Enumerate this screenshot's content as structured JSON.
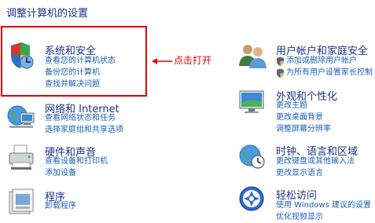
{
  "page": {
    "title": "调整计算机的设置"
  },
  "annotation": {
    "text": "点击打开",
    "color": "#e00000"
  },
  "categories": {
    "system_security": {
      "title": "系统和安全",
      "links": [
        "查看您的计算机状态",
        "备份您的计算机",
        "查找并解决问题"
      ]
    },
    "network_internet": {
      "title": "网络和 Internet",
      "links": [
        "查看网络状态和任务",
        "选择家庭组和共享选项"
      ]
    },
    "hardware_sound": {
      "title": "硬件和声音",
      "links": [
        "查看设备和打印机",
        "添加设备"
      ]
    },
    "programs": {
      "title": "程序",
      "links": [
        "卸载程序"
      ]
    },
    "user_accounts": {
      "title": "用户帐户和家庭安全",
      "links": [
        "添加或删除用户帐户",
        "为所有用户设置家长控制"
      ]
    },
    "appearance": {
      "title": "外观和个性化",
      "links": [
        "更改主题",
        "更改桌面背景",
        "调整屏幕分辨率"
      ]
    },
    "clock_language": {
      "title": "时钟、语言和区域",
      "links": [
        "更改键盘或其他输入法",
        "更改显示语言"
      ]
    },
    "ease_access": {
      "title": "轻松访问",
      "links": [
        "使用 Windows 建议的设置",
        "优化视频显示"
      ]
    }
  },
  "colors": {
    "heading": "#1e3287",
    "link": "#1a5fb4",
    "highlight": "#e00000"
  }
}
